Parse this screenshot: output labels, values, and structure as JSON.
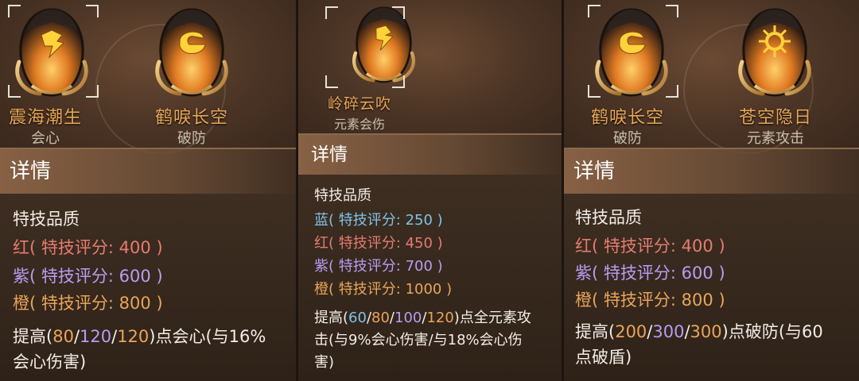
{
  "panel1": {
    "gems": [
      {
        "name": "震海潮生",
        "stat": "会心",
        "icon": "lightning-crest-icon"
      },
      {
        "name": "鹤唳长空",
        "stat": "破防",
        "icon": "swirl-crest-icon"
      }
    ],
    "detail_title": "详情",
    "quality_heading": "特技品质",
    "tiers": [
      {
        "color": "红",
        "label": "特技评分:",
        "score": "400",
        "open": "(",
        "close": ")"
      },
      {
        "color": "紫",
        "label": "特技评分:",
        "score": "600",
        "open": "(",
        "close": ")"
      },
      {
        "color": "橙",
        "label": "特技评分:",
        "score": "800",
        "open": "(",
        "close": ")"
      }
    ],
    "desc": {
      "prefix": "提高(",
      "v1": "80",
      "s1": "/",
      "v2": "120",
      "s2": "/",
      "v3": "120",
      "suffix1": ")点会心(与16%",
      "suffix2": "会心伤害)"
    }
  },
  "panel2": {
    "gem": {
      "name": "岭碎云吹",
      "stat": "元素会伤",
      "icon": "lightning-crest-icon"
    },
    "detail_title": "详情",
    "quality_heading": "特技品质",
    "tiers": [
      {
        "color": "蓝",
        "label": "特技评分:",
        "score": "250",
        "open": "(",
        "close": ")"
      },
      {
        "color": "红",
        "label": "特技评分:",
        "score": "450",
        "open": "(",
        "close": ")"
      },
      {
        "color": "紫",
        "label": "特技评分:",
        "score": "700",
        "open": "(",
        "close": ")"
      },
      {
        "color": "橙",
        "label": "特技评分:",
        "score": "1000",
        "open": "(",
        "close": ")"
      }
    ],
    "desc": {
      "prefix": "提高(",
      "v1": "60",
      "s1": "/",
      "v2": "80",
      "s2": "/",
      "v3": "100",
      "s3": "/",
      "v4": "120",
      "suffix1": ")点全元素攻",
      "line2": "击(与9%会心伤害/与18%会心伤",
      "line3": "害)"
    }
  },
  "panel3": {
    "gems": [
      {
        "name": "鹤唳长空",
        "stat": "破防",
        "icon": "swirl-crest-icon"
      },
      {
        "name": "苍空隐日",
        "stat": "元素攻击",
        "icon": "sun-crest-icon"
      }
    ],
    "detail_title": "详情",
    "quality_heading": "特技品质",
    "tiers": [
      {
        "color": "红",
        "label": "特技评分:",
        "score": "400",
        "open": "(",
        "close": ")"
      },
      {
        "color": "紫",
        "label": "特技评分:",
        "score": "600",
        "open": "(",
        "close": ")"
      },
      {
        "color": "橙",
        "label": "特技评分:",
        "score": "800",
        "open": "(",
        "close": ")"
      }
    ],
    "desc": {
      "prefix": "提高(",
      "v1": "200",
      "s1": "/",
      "v2": "300",
      "s2": "/",
      "v3": "300",
      "suffix1": ")点破防(与60",
      "suffix2": "点破盾)"
    }
  },
  "colors": {
    "red": "#e57c70",
    "purple": "#b79df2",
    "orange": "#e9a55a",
    "blue": "#7fc3e8",
    "name_gold": "#e9a657"
  }
}
